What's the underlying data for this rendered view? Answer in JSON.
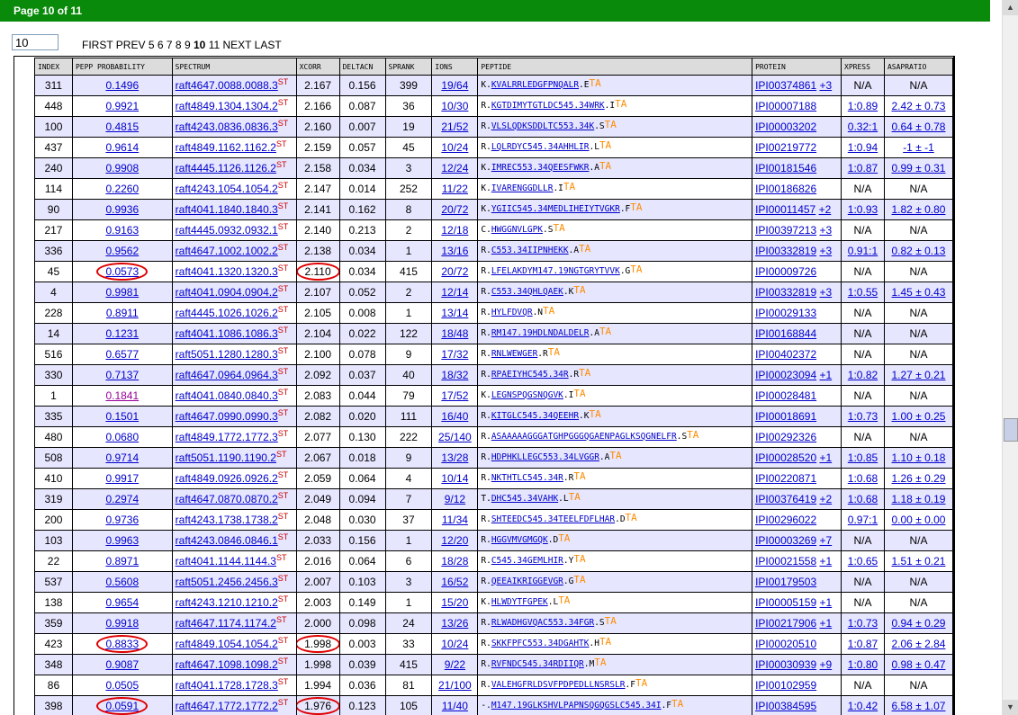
{
  "window": {
    "title": "Page 10 of 11"
  },
  "pager": {
    "input_value": "10",
    "first": "FIRST",
    "prev": "PREV",
    "pages": [
      "5",
      "6",
      "7",
      "8",
      "9",
      "10",
      "11"
    ],
    "current": "10",
    "next": "NEXT",
    "last": "LAST"
  },
  "columns": [
    "INDEX",
    "PEPP PROBABILITY",
    "SPECTRUM",
    "XCORR",
    "DELTACN",
    "SPRANK",
    "IONS",
    "PEPTIDE",
    "PROTEIN",
    "XPRESS",
    "ASAPRATIO"
  ],
  "spectrum_suffix": "ST",
  "peptide_marker": "TA",
  "rows": [
    {
      "index": "311",
      "prob": "0.1496",
      "spectrum": "raft4647.0088.0088.3",
      "xcorr": "2.167",
      "deltacn": "0.156",
      "sprank": "399",
      "ions": "19/64",
      "pep_pre": "K.",
      "pep_main": "KVALRRLEDGFPNQALR",
      "pep_post": ".E",
      "protein": "IPI00374861",
      "protein_extra": "+3",
      "xpress": "N/A",
      "asap": "N/A",
      "xpress_link": false,
      "asap_link": false
    },
    {
      "index": "448",
      "prob": "0.9921",
      "spectrum": "raft4849.1304.1304.2",
      "xcorr": "2.166",
      "deltacn": "0.087",
      "sprank": "36",
      "ions": "10/30",
      "pep_pre": "R.",
      "pep_main": "KGTDIMYTGTLDC545.34WRK",
      "pep_post": ".I",
      "protein": "IPI00007188",
      "protein_extra": "",
      "xpress": "1:0.89",
      "asap": "2.42 ± 0.73",
      "xpress_link": true,
      "asap_link": true
    },
    {
      "index": "100",
      "prob": "0.4815",
      "spectrum": "raft4243.0836.0836.3",
      "xcorr": "2.160",
      "deltacn": "0.007",
      "sprank": "19",
      "ions": "21/52",
      "pep_pre": "R.",
      "pep_main": "VLSLQDKSDDLTC553.34K",
      "pep_post": ".S",
      "protein": "IPI00003202",
      "protein_extra": "",
      "xpress": "0.32:1",
      "asap": "0.64 ± 0.78",
      "xpress_link": true,
      "asap_link": true
    },
    {
      "index": "437",
      "prob": "0.9614",
      "spectrum": "raft4849.1162.1162.2",
      "xcorr": "2.159",
      "deltacn": "0.057",
      "sprank": "45",
      "ions": "10/24",
      "pep_pre": "R.",
      "pep_main": "LQLRDYC545.34AHHLIR",
      "pep_post": ".L",
      "protein": "IPI00219772",
      "protein_extra": "",
      "xpress": "1:0.94",
      "asap": "-1 ± -1",
      "xpress_link": true,
      "asap_link": true
    },
    {
      "index": "240",
      "prob": "0.9908",
      "spectrum": "raft4445.1126.1126.2",
      "xcorr": "2.158",
      "deltacn": "0.034",
      "sprank": "3",
      "ions": "12/24",
      "pep_pre": "K.",
      "pep_main": "IMREC553.34QEESFWKR",
      "pep_post": ".A",
      "protein": "IPI00181546",
      "protein_extra": "",
      "xpress": "1:0.87",
      "asap": "0.99 ± 0.31",
      "xpress_link": true,
      "asap_link": true
    },
    {
      "index": "114",
      "prob": "0.2260",
      "spectrum": "raft4243.1054.1054.2",
      "xcorr": "2.147",
      "deltacn": "0.014",
      "sprank": "252",
      "ions": "11/22",
      "pep_pre": "K.",
      "pep_main": "IVARENGGDLLR",
      "pep_post": ".I",
      "protein": "IPI00186826",
      "protein_extra": "",
      "xpress": "N/A",
      "asap": "N/A",
      "xpress_link": false,
      "asap_link": false
    },
    {
      "index": "90",
      "prob": "0.9936",
      "spectrum": "raft4041.1840.1840.3",
      "xcorr": "2.141",
      "deltacn": "0.162",
      "sprank": "8",
      "ions": "20/72",
      "pep_pre": "K.",
      "pep_main": "YGIIC545.34MEDLIHEIYTVGKR",
      "pep_post": ".F",
      "protein": "IPI00011457",
      "protein_extra": "+2",
      "xpress": "1:0.93",
      "asap": "1.82 ± 0.80",
      "xpress_link": true,
      "asap_link": true
    },
    {
      "index": "217",
      "prob": "0.9163",
      "spectrum": "raft4445.0932.0932.1",
      "xcorr": "2.140",
      "deltacn": "0.213",
      "sprank": "2",
      "ions": "12/18",
      "pep_pre": "C.",
      "pep_main": "HWGGNVLGPK",
      "pep_post": ".S",
      "protein": "IPI00397213",
      "protein_extra": "+3",
      "xpress": "N/A",
      "asap": "N/A",
      "xpress_link": false,
      "asap_link": false
    },
    {
      "index": "336",
      "prob": "0.9562",
      "spectrum": "raft4647.1002.1002.2",
      "xcorr": "2.138",
      "deltacn": "0.034",
      "sprank": "1",
      "ions": "13/16",
      "pep_pre": "R.",
      "pep_main": "C553.34IIPNHEKK",
      "pep_post": ".A",
      "protein": "IPI00332819",
      "protein_extra": "+3",
      "xpress": "0.91:1",
      "asap": "0.82 ± 0.13",
      "xpress_link": true,
      "asap_link": true
    },
    {
      "index": "45",
      "prob": "0.0573",
      "spectrum": "raft4041.1320.1320.3",
      "xcorr": "2.110",
      "deltacn": "0.034",
      "sprank": "415",
      "ions": "20/72",
      "pep_pre": "R.",
      "pep_main": "LFELAKDYM147.19NGTGRYTVVK",
      "pep_post": ".G",
      "protein": "IPI00009726",
      "protein_extra": "",
      "xpress": "N/A",
      "asap": "N/A",
      "xpress_link": false,
      "asap_link": false,
      "circled": true
    },
    {
      "index": "4",
      "prob": "0.9981",
      "spectrum": "raft4041.0904.0904.2",
      "xcorr": "2.107",
      "deltacn": "0.052",
      "sprank": "2",
      "ions": "12/14",
      "pep_pre": "R.",
      "pep_main": "C553.34QHLQAEK",
      "pep_post": ".K",
      "protein": "IPI00332819",
      "protein_extra": "+3",
      "xpress": "1:0.55",
      "asap": "1.45 ± 0.43",
      "xpress_link": true,
      "asap_link": true
    },
    {
      "index": "228",
      "prob": "0.8911",
      "spectrum": "raft4445.1026.1026.2",
      "xcorr": "2.105",
      "deltacn": "0.008",
      "sprank": "1",
      "ions": "13/14",
      "pep_pre": "R.",
      "pep_main": "HYLFDVQR",
      "pep_post": ".N",
      "protein": "IPI00029133",
      "protein_extra": "",
      "xpress": "N/A",
      "asap": "N/A",
      "xpress_link": false,
      "asap_link": false
    },
    {
      "index": "14",
      "prob": "0.1231",
      "spectrum": "raft4041.1086.1086.3",
      "xcorr": "2.104",
      "deltacn": "0.022",
      "sprank": "122",
      "ions": "18/48",
      "pep_pre": "R.",
      "pep_main": "RM147.19HDLNDALDELR",
      "pep_post": ".A",
      "protein": "IPI00168844",
      "protein_extra": "",
      "xpress": "N/A",
      "asap": "N/A",
      "xpress_link": false,
      "asap_link": false
    },
    {
      "index": "516",
      "prob": "0.6577",
      "spectrum": "raft5051.1280.1280.3",
      "xcorr": "2.100",
      "deltacn": "0.078",
      "sprank": "9",
      "ions": "17/32",
      "pep_pre": "R.",
      "pep_main": "RNLWEWGER",
      "pep_post": ".R",
      "protein": "IPI00402372",
      "protein_extra": "",
      "xpress": "N/A",
      "asap": "N/A",
      "xpress_link": false,
      "asap_link": false
    },
    {
      "index": "330",
      "prob": "0.7137",
      "spectrum": "raft4647.0964.0964.3",
      "xcorr": "2.092",
      "deltacn": "0.037",
      "sprank": "40",
      "ions": "18/32",
      "pep_pre": "R.",
      "pep_main": "RPAEIYHC545.34R",
      "pep_post": ".R",
      "protein": "IPI00023094",
      "protein_extra": "+1",
      "xpress": "1:0.82",
      "asap": "1.27 ± 0.21",
      "xpress_link": true,
      "asap_link": true
    },
    {
      "index": "1",
      "prob": "0.1841",
      "spectrum": "raft4041.0840.0840.3",
      "xcorr": "2.083",
      "deltacn": "0.044",
      "sprank": "79",
      "ions": "17/52",
      "pep_pre": "K.",
      "pep_main": "LEGNSPQGSNQGVK",
      "pep_post": ".I",
      "protein": "IPI00028481",
      "protein_extra": "",
      "xpress": "N/A",
      "asap": "N/A",
      "xpress_link": false,
      "asap_link": false,
      "visited": true
    },
    {
      "index": "335",
      "prob": "0.1501",
      "spectrum": "raft4647.0990.0990.3",
      "xcorr": "2.082",
      "deltacn": "0.020",
      "sprank": "111",
      "ions": "16/40",
      "pep_pre": "R.",
      "pep_main": "KITGLC545.34QEEHR",
      "pep_post": ".K",
      "protein": "IPI00018691",
      "protein_extra": "",
      "xpress": "1:0.73",
      "asap": "1.00 ± 0.25",
      "xpress_link": true,
      "asap_link": true
    },
    {
      "index": "480",
      "prob": "0.0680",
      "spectrum": "raft4849.1772.1772.3",
      "xcorr": "2.077",
      "deltacn": "0.130",
      "sprank": "222",
      "ions": "25/140",
      "pep_pre": "R.",
      "pep_main": "ASAAAAAGGGATGHPGGGQGAENPAGLKSQGNELFR",
      "pep_post": ".S",
      "protein": "IPI00292326",
      "protein_extra": "",
      "xpress": "N/A",
      "asap": "N/A",
      "xpress_link": false,
      "asap_link": false
    },
    {
      "index": "508",
      "prob": "0.9714",
      "spectrum": "raft5051.1190.1190.2",
      "xcorr": "2.067",
      "deltacn": "0.018",
      "sprank": "9",
      "ions": "13/28",
      "pep_pre": "R.",
      "pep_main": "HDPHKLLEGC553.34LVGGR",
      "pep_post": ".A",
      "protein": "IPI00028520",
      "protein_extra": "+1",
      "xpress": "1:0.85",
      "asap": "1.10 ± 0.18",
      "xpress_link": true,
      "asap_link": true
    },
    {
      "index": "410",
      "prob": "0.9917",
      "spectrum": "raft4849.0926.0926.2",
      "xcorr": "2.059",
      "deltacn": "0.064",
      "sprank": "4",
      "ions": "10/14",
      "pep_pre": "R.",
      "pep_main": "NKTHTLC545.34R",
      "pep_post": ".R",
      "protein": "IPI00220871",
      "protein_extra": "",
      "xpress": "1:0.68",
      "asap": "1.26 ± 0.29",
      "xpress_link": true,
      "asap_link": true
    },
    {
      "index": "319",
      "prob": "0.2974",
      "spectrum": "raft4647.0870.0870.2",
      "xcorr": "2.049",
      "deltacn": "0.094",
      "sprank": "7",
      "ions": "9/12",
      "pep_pre": "T.",
      "pep_main": "DHC545.34VAHK",
      "pep_post": ".L",
      "protein": "IPI00376419",
      "protein_extra": "+2",
      "xpress": "1:0.68",
      "asap": "1.18 ± 0.19",
      "xpress_link": true,
      "asap_link": true
    },
    {
      "index": "200",
      "prob": "0.9736",
      "spectrum": "raft4243.1738.1738.2",
      "xcorr": "2.048",
      "deltacn": "0.030",
      "sprank": "37",
      "ions": "11/34",
      "pep_pre": "R.",
      "pep_main": "SHTEEDC545.34TEELFDFLHAR",
      "pep_post": ".D",
      "protein": "IPI00296022",
      "protein_extra": "",
      "xpress": "0.97:1",
      "asap": "0.00 ± 0.00",
      "xpress_link": true,
      "asap_link": true
    },
    {
      "index": "103",
      "prob": "0.9963",
      "spectrum": "raft4243.0846.0846.1",
      "xcorr": "2.033",
      "deltacn": "0.156",
      "sprank": "1",
      "ions": "12/20",
      "pep_pre": "R.",
      "pep_main": "HGGVMVGMGQK",
      "pep_post": ".D",
      "protein": "IPI00003269",
      "protein_extra": "+7",
      "xpress": "N/A",
      "asap": "N/A",
      "xpress_link": false,
      "asap_link": false
    },
    {
      "index": "22",
      "prob": "0.8971",
      "spectrum": "raft4041.1144.1144.3",
      "xcorr": "2.016",
      "deltacn": "0.064",
      "sprank": "6",
      "ions": "18/28",
      "pep_pre": "R.",
      "pep_main": "C545.34GEMLHIR",
      "pep_post": ".Y",
      "protein": "IPI00021558",
      "protein_extra": "+1",
      "xpress": "1:0.65",
      "asap": "1.51 ± 0.21",
      "xpress_link": true,
      "asap_link": true
    },
    {
      "index": "537",
      "prob": "0.5608",
      "spectrum": "raft5051.2456.2456.3",
      "xcorr": "2.007",
      "deltacn": "0.103",
      "sprank": "3",
      "ions": "16/52",
      "pep_pre": "R.",
      "pep_main": "QEEAIKRIGGEVGR",
      "pep_post": ".G",
      "protein": "IPI00179503",
      "protein_extra": "",
      "xpress": "N/A",
      "asap": "N/A",
      "xpress_link": false,
      "asap_link": false
    },
    {
      "index": "138",
      "prob": "0.9654",
      "spectrum": "raft4243.1210.1210.2",
      "xcorr": "2.003",
      "deltacn": "0.149",
      "sprank": "1",
      "ions": "15/20",
      "pep_pre": "K.",
      "pep_main": "HLWDYTFGPEK",
      "pep_post": ".L",
      "protein": "IPI00005159",
      "protein_extra": "+1",
      "xpress": "N/A",
      "asap": "N/A",
      "xpress_link": false,
      "asap_link": false
    },
    {
      "index": "359",
      "prob": "0.9918",
      "spectrum": "raft4647.1174.1174.2",
      "xcorr": "2.000",
      "deltacn": "0.098",
      "sprank": "24",
      "ions": "13/26",
      "pep_pre": "R.",
      "pep_main": "RLWADHGVQAC553.34FGR",
      "pep_post": ".S",
      "protein": "IPI00217906",
      "protein_extra": "+1",
      "xpress": "1:0.73",
      "asap": "0.94 ± 0.29",
      "xpress_link": true,
      "asap_link": true
    },
    {
      "index": "423",
      "prob": "0.8833",
      "spectrum": "raft4849.1054.1054.2",
      "xcorr": "1.998",
      "deltacn": "0.003",
      "sprank": "33",
      "ions": "10/24",
      "pep_pre": "R.",
      "pep_main": "SKKFPFC553.34DGAHTK",
      "pep_post": ".H",
      "protein": "IPI00020510",
      "protein_extra": "",
      "xpress": "1:0.87",
      "asap": "2.06 ± 2.84",
      "xpress_link": true,
      "asap_link": true,
      "circled": true
    },
    {
      "index": "348",
      "prob": "0.9087",
      "spectrum": "raft4647.1098.1098.2",
      "xcorr": "1.998",
      "deltacn": "0.039",
      "sprank": "415",
      "ions": "9/22",
      "pep_pre": "R.",
      "pep_main": "RVFNDC545.34RDIIQR",
      "pep_post": ".M",
      "protein": "IPI00030939",
      "protein_extra": "+9",
      "xpress": "1:0.80",
      "asap": "0.98 ± 0.47",
      "xpress_link": true,
      "asap_link": true
    },
    {
      "index": "86",
      "prob": "0.0505",
      "spectrum": "raft4041.1728.1728.3",
      "xcorr": "1.994",
      "deltacn": "0.036",
      "sprank": "81",
      "ions": "21/100",
      "pep_pre": "R.",
      "pep_main": "VALEHGFRLDSVFPDPEDLLNSRSLR",
      "pep_post": ".F",
      "protein": "IPI00102959",
      "protein_extra": "",
      "xpress": "N/A",
      "asap": "N/A",
      "xpress_link": false,
      "asap_link": false
    },
    {
      "index": "398",
      "prob": "0.0591",
      "spectrum": "raft4647.1772.1772.2",
      "xcorr": "1.976",
      "deltacn": "0.123",
      "sprank": "105",
      "ions": "11/40",
      "pep_pre": "-.",
      "pep_main": "M147.19GLKSHVLPAPNSQGQGSLC545.34I",
      "pep_post": ".F",
      "protein": "IPI00384595",
      "protein_extra": "",
      "xpress": "1:0.42",
      "asap": "6.58 ± 1.07",
      "xpress_link": true,
      "asap_link": true,
      "circled": true
    }
  ]
}
